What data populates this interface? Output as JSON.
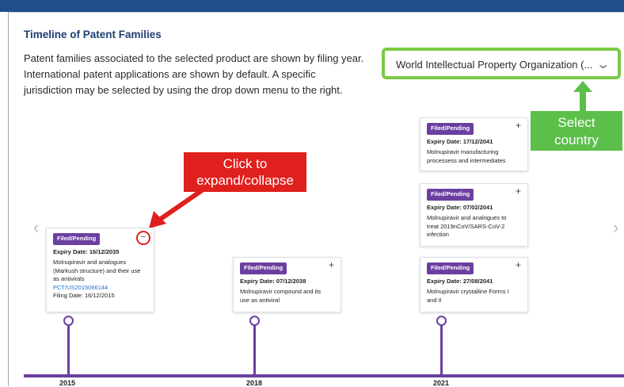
{
  "header": {
    "title": "Timeline of Patent Families"
  },
  "description": [
    "Patent families associated to the selected product are shown by filing year.",
    "International patent applications are shown by default. A specific",
    "jurisdiction may be selected by using the drop down menu to the right."
  ],
  "jurisdiction_select": {
    "value": "World Intellectual Property Organization (..."
  },
  "callouts": {
    "select_country": [
      "Select",
      "country"
    ],
    "expand_collapse": [
      "Click to",
      "expand/collapse"
    ]
  },
  "years": [
    "2015",
    "2018",
    "2021"
  ],
  "cards": {
    "c2015": {
      "status": "Filed/Pending",
      "expiry": "Expiry Date: 16/12/2035",
      "title_lines": [
        "Molnupiravir and analogues",
        "(Markush structure) and their use",
        "as antivirals"
      ],
      "link": "PCT/US2015066144",
      "filing": "Filing Date: 16/12/2015",
      "toggle": "−"
    },
    "c2018": {
      "status": "Filed/Pending",
      "expiry": "Expiry Date: 07/12/2038",
      "title_lines": [
        "Molnupiravir compound and its",
        "use as antiviral"
      ],
      "toggle": "+"
    },
    "c2021a": {
      "status": "Filed/Pending",
      "expiry": "Expiry Date: 17/12/2041",
      "title_lines": [
        "Molnupiravir manufacturing",
        "processess and intermediates"
      ],
      "toggle": "+"
    },
    "c2021b": {
      "status": "Filed/Pending",
      "expiry": "Expiry Date: 07/02/2041",
      "title_lines": [
        "Molnupiravir and analogues to",
        "treat 2019nCoV/SARS-CoV-2",
        "infection"
      ],
      "toggle": "+"
    },
    "c2021c": {
      "status": "Filed/Pending",
      "expiry": "Expiry Date: 27/08/2041",
      "title_lines": [
        "Molnupiravir crystalline Forms I",
        "and II"
      ],
      "toggle": "+"
    }
  },
  "nav": {
    "prev": "‹",
    "next": "›"
  },
  "colors": {
    "accent": "#6b3fa0",
    "header": "#1f4e8c",
    "callout_green": "#5cbf4a",
    "callout_red": "#e0201d"
  }
}
